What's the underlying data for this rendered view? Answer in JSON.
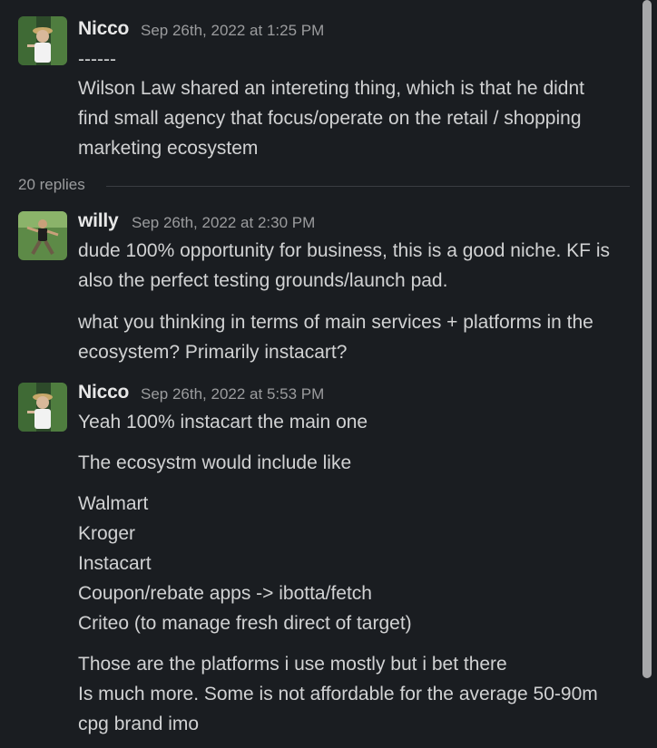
{
  "messages": [
    {
      "author": "Nicco",
      "timestamp": "Sep 26th, 2022 at 1:25 PM",
      "lines": [
        "------",
        "Wilson Law shared an intereting thing, which is that he didnt",
        "find small agency that focus/operate on the retail / shopping",
        "marketing ecosystem"
      ]
    },
    {
      "author": "willy",
      "timestamp": "Sep 26th, 2022 at 2:30 PM",
      "lines": [
        "dude 100% opportunity for business, this is a good niche. KF is",
        "also the perfect testing grounds/launch pad.",
        "what you thinking in terms of main services + platforms in the",
        "ecosystem? Primarily instacart?"
      ]
    },
    {
      "author": "Nicco",
      "timestamp": "Sep 26th, 2022 at 5:53 PM",
      "lines": [
        "Yeah 100% instacart the main one",
        "The ecosystm would include like",
        "Walmart",
        "Kroger",
        "Instacart",
        "Coupon/rebate apps -> ibotta/fetch",
        "Criteo (to manage fresh direct of target)",
        "Those are the platforms i use mostly but i bet there",
        "Is much more. Some is not affordable for the average 50-90m",
        "cpg brand imo"
      ]
    }
  ],
  "thread": {
    "replies_label": "20 replies"
  },
  "icons": {
    "avatar_nicco": "avatar-photo",
    "avatar_willy": "avatar-photo"
  }
}
